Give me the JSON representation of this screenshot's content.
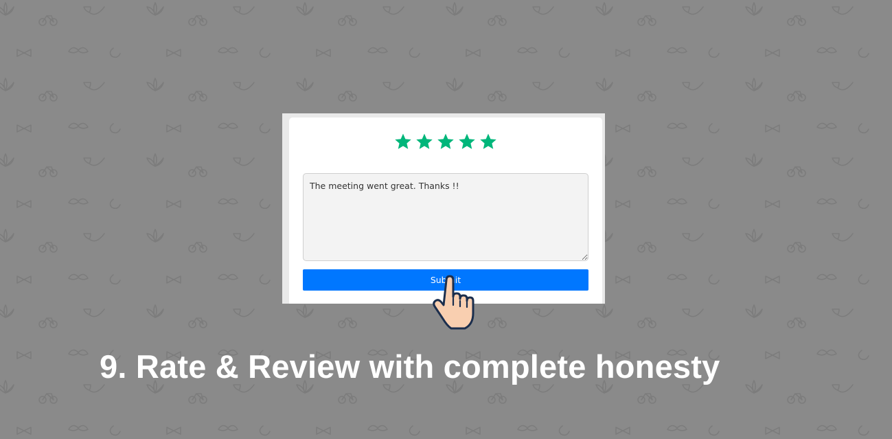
{
  "colors": {
    "background": "#8a8a8a",
    "star": "#00b67a",
    "button": "#0077ff",
    "caption": "#ffffff"
  },
  "review_form": {
    "rating": 5,
    "max_rating": 5,
    "star_icon": "star-icon",
    "review_text": "The meeting went great. Thanks !!",
    "submit_label": "Submit"
  },
  "cursor_icon": "pointing-hand-cursor-icon",
  "caption": "9. Rate & Review with complete honesty"
}
